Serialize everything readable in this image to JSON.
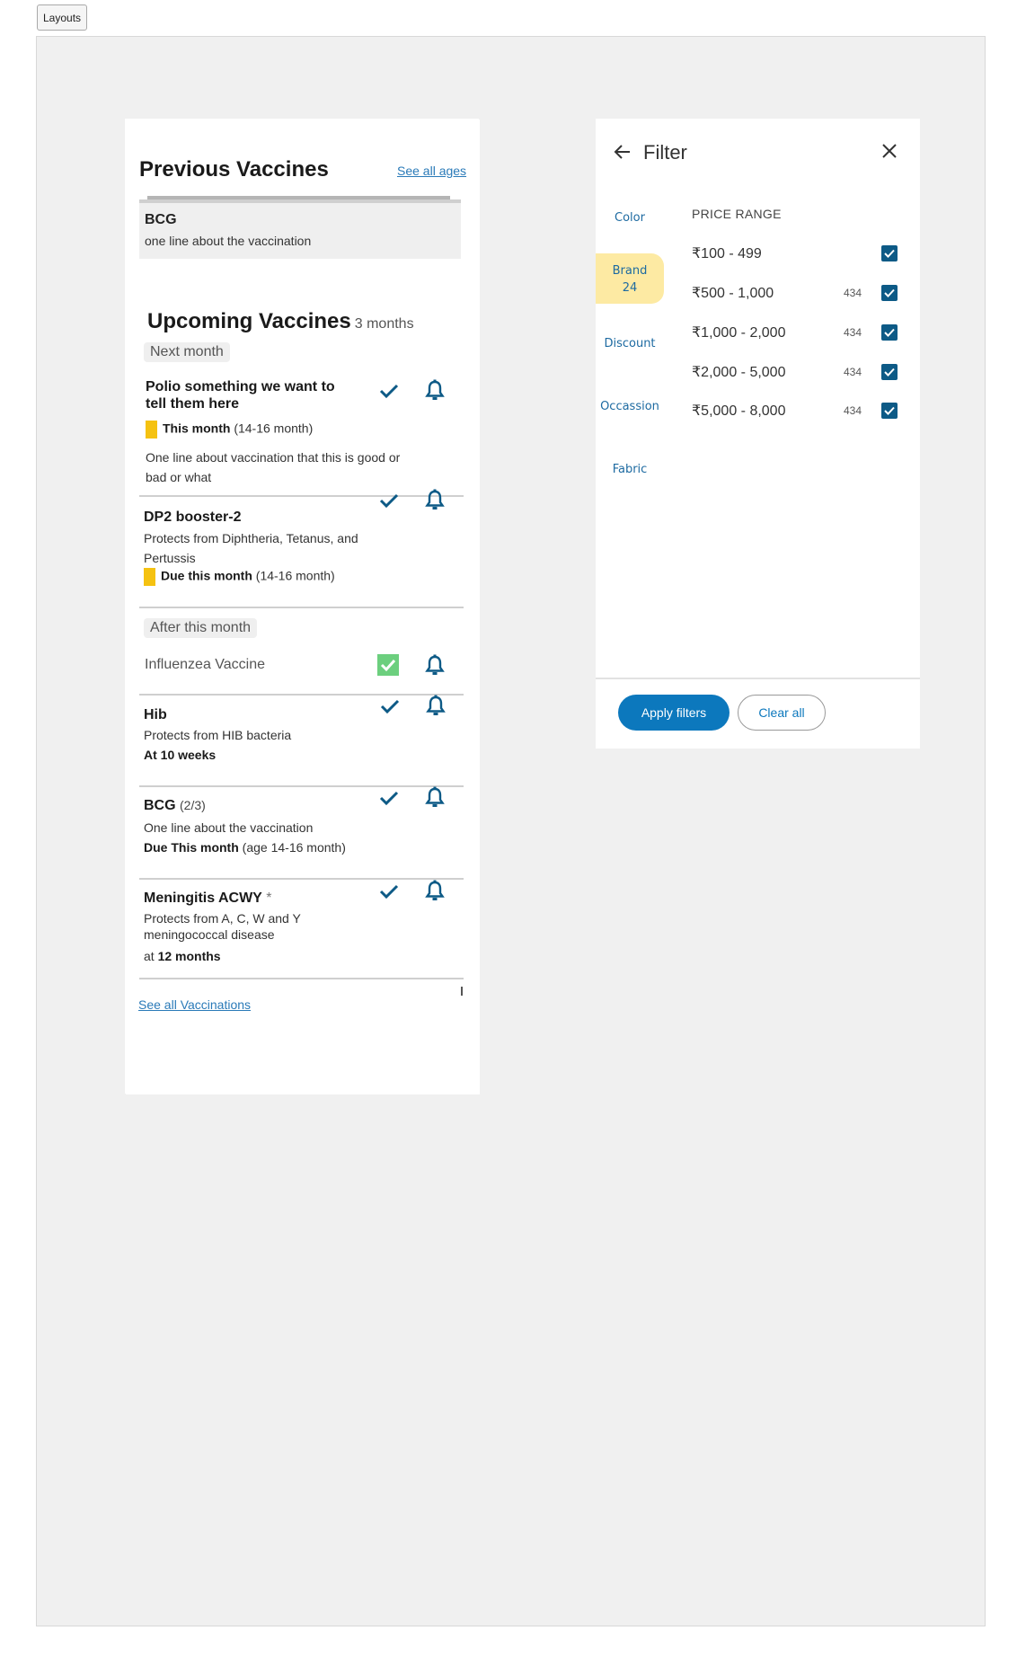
{
  "toolbar": {
    "layouts_label": "Layouts"
  },
  "vaccines": {
    "previous_title": "Previous Vaccines",
    "see_all_ages": "See all ages",
    "previous_item": {
      "name": "BCG",
      "desc": "one line about the vaccination"
    },
    "upcoming_title": "Upcoming Vaccines",
    "upcoming_sub": "3 months",
    "next_month_label": "Next month",
    "items": [
      {
        "title": "Polio something we want to tell them here",
        "due_strong": "This month",
        "due_rest": " (14-16 month)",
        "desc": "One line about vaccination that this is good or bad or what"
      },
      {
        "title": "DP2 booster-2",
        "desc": "Protects from Diphtheria, Tetanus, and Pertussis",
        "due_strong": "Due this month",
        "due_rest": " (14-16 month)"
      }
    ],
    "after_month_label": "After this month",
    "influenza": "Influenzea Vaccine",
    "hib": {
      "title": "Hib",
      "desc": "Protects from HIB bacteria",
      "when": "At 10 weeks"
    },
    "bcg2": {
      "title": "BCG",
      "dose": "(2/3)",
      "desc": "One line about the vaccination",
      "due_strong": "Due This month",
      "due_rest": " (age 14-16 month)"
    },
    "mening": {
      "title": "Meningitis ACWY",
      "mark": "*",
      "desc": "Protects from A, C, W and Y meningococcal disease",
      "when_pre": "at ",
      "when_strong": "12 months"
    },
    "see_all_vaccinations": "See all Vaccinations",
    "colors": {
      "yellow_bar": "#f5c211",
      "check": "#0d5a86",
      "green_check": "#6ccf7e"
    }
  },
  "filter": {
    "title": "Filter",
    "sidebar": {
      "color": "Color",
      "brand": "Brand",
      "brand_count": "24",
      "discount": "Discount",
      "occassion": "Occassion",
      "fabric": "Fabric"
    },
    "section_title": "PRICE RANGE",
    "ranges": [
      {
        "label": "₹100 - 499",
        "count": ""
      },
      {
        "label": "₹500 - 1,000",
        "count": "434"
      },
      {
        "label": "₹1,000 - 2,000",
        "count": "434"
      },
      {
        "label": "₹2,000 - 5,000",
        "count": "434"
      },
      {
        "label": "₹5,000 - 8,000",
        "count": "434"
      }
    ],
    "apply_label": "Apply filters",
    "clear_label": "Clear all",
    "colors": {
      "accent": "#0c78bd",
      "active_tab": "#fdeaa3",
      "checkbox": "#0d5a86"
    }
  }
}
